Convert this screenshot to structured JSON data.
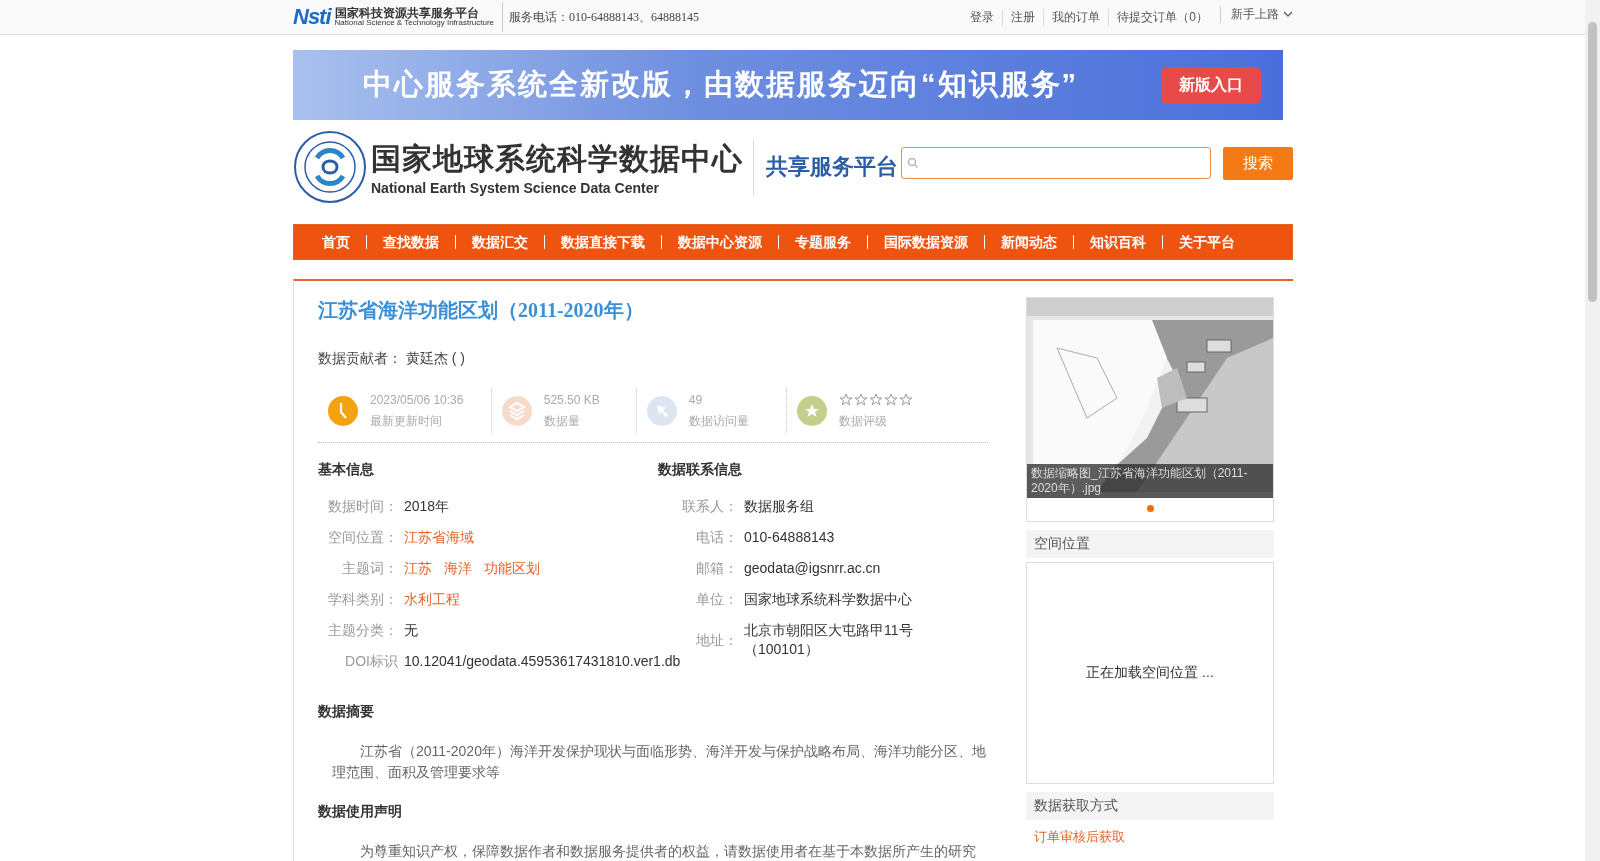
{
  "topbar": {
    "logo_mark": "Nsti",
    "logo_cn": "国家科技资源共享服务平台",
    "logo_en": "National Science & Technology Infrastructure",
    "phone": "服务电话：010-64888143、64888145",
    "links": [
      "登录",
      "注册",
      "我的订单",
      "待提交订单（0）"
    ],
    "guide": "新手上路"
  },
  "banner": {
    "text": "中心服务系统全新改版，由数据服务迈向“知识服务”",
    "button": "新版入口"
  },
  "header": {
    "title_cn": "国家地球系统科学数据中心",
    "title_en": "National Earth System Science Data Center",
    "subtitle": "共享服务平台",
    "search_button": "搜索"
  },
  "nav": [
    "首页",
    "查找数据",
    "数据汇交",
    "数据直接下载",
    "数据中心资源",
    "专题服务",
    "国际数据资源",
    "新闻动态",
    "知识百科",
    "关于平台"
  ],
  "dataset": {
    "title": "江苏省海洋功能区划（2011-2020年）",
    "contributor_label": "数据贡献者：",
    "contributor": "黄廷杰 ( )",
    "stats": [
      {
        "kind": "clock",
        "value": "2023/05/06 10:36",
        "label": "最新更新时间"
      },
      {
        "kind": "layers",
        "value": "525.50 KB",
        "label": "数据量"
      },
      {
        "kind": "cursor",
        "value": "49",
        "label": "数据访问量"
      },
      {
        "kind": "rating",
        "stars": 0,
        "label": "数据评级"
      }
    ]
  },
  "basic_info": {
    "heading": "基本信息",
    "rows": [
      {
        "label": "数据时间：",
        "kind": "text",
        "value": "2018年"
      },
      {
        "label": "空间位置：",
        "kind": "links",
        "values": [
          "江苏省海域"
        ]
      },
      {
        "label": "主题词：",
        "kind": "links",
        "values": [
          "江苏",
          "海洋",
          "功能区划"
        ]
      },
      {
        "label": "学科类别：",
        "kind": "links",
        "values": [
          "水利工程"
        ]
      },
      {
        "label": "主题分类：",
        "kind": "text",
        "value": "无"
      },
      {
        "label": "DOI标识",
        "kind": "text",
        "value": "10.12041/geodata.45953617431810.ver1.db"
      }
    ]
  },
  "contact_info": {
    "heading": "数据联系信息",
    "rows": [
      {
        "label": "联系人：",
        "value": "数据服务组"
      },
      {
        "label": "电话：",
        "value": "010-64888143"
      },
      {
        "label": "邮箱：",
        "value": "geodata@igsnrr.ac.cn"
      },
      {
        "label": "单位：",
        "value": "国家地球系统科学数据中心"
      },
      {
        "label": "地址：",
        "value": "北京市朝阳区大屯路甲11号（100101）"
      }
    ]
  },
  "abstract": {
    "heading": "数据摘要",
    "text": "江苏省（2011-2020年）海洋开发保护现状与面临形势、海洋开发与保护战略布局、海洋功能分区、地理范围、面积及管理要求等"
  },
  "usage": {
    "heading": "数据使用声明",
    "text": "为尊重知识产权，保障数据作者和数据服务提供者的权益，请数据使用者在基于本数据所产生的研究"
  },
  "sidebar": {
    "thumbnail": {
      "kind": "picture",
      "caption": "数据缩略图_江苏省海洋功能区划（2011-2020年）.jpg",
      "dots": [
        {
          "selected": true
        }
      ]
    },
    "location_heading": "空间位置",
    "location_loading": "正在加载空间位置 ...",
    "access_heading": "数据获取方式",
    "access_link": "订单审核后获取"
  }
}
